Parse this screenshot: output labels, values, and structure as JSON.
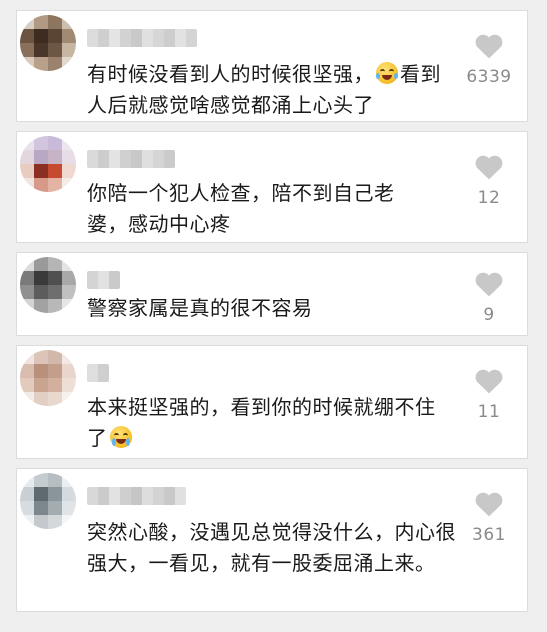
{
  "colors": {
    "page_background": "#efefef",
    "card_background": "#ffffff",
    "text": "#1a1a1a",
    "like_icon": "#c8c8c8",
    "like_count": "#8a8a8a"
  },
  "comments": [
    {
      "username": "",
      "text_before_emoji": "有时候没看到人的时候很坚强，",
      "emoji": "rolling-laughing-emoji",
      "text_after_emoji": "看到人后就感觉啥感觉都涌上心头了",
      "likes": "6339"
    },
    {
      "username": "",
      "text_before_emoji": "你陪一个犯人检查，陪不到自己老婆，感动中心疼",
      "emoji": "",
      "text_after_emoji": "",
      "likes": "12"
    },
    {
      "username": "",
      "text_before_emoji": "警察家属是真的很不容易",
      "emoji": "",
      "text_after_emoji": "",
      "likes": "9"
    },
    {
      "username": "",
      "text_before_emoji": "本来挺坚强的，看到你的时候就绷不住了",
      "emoji": "loudly-crying-emoji",
      "text_after_emoji": "",
      "likes": "11"
    },
    {
      "username": "",
      "text_before_emoji": "突然心酸，没遇见总觉得没什么，内心很强大，一看见，就有一股委屈涌上来。",
      "emoji": "",
      "text_after_emoji": "",
      "likes": "361"
    }
  ]
}
